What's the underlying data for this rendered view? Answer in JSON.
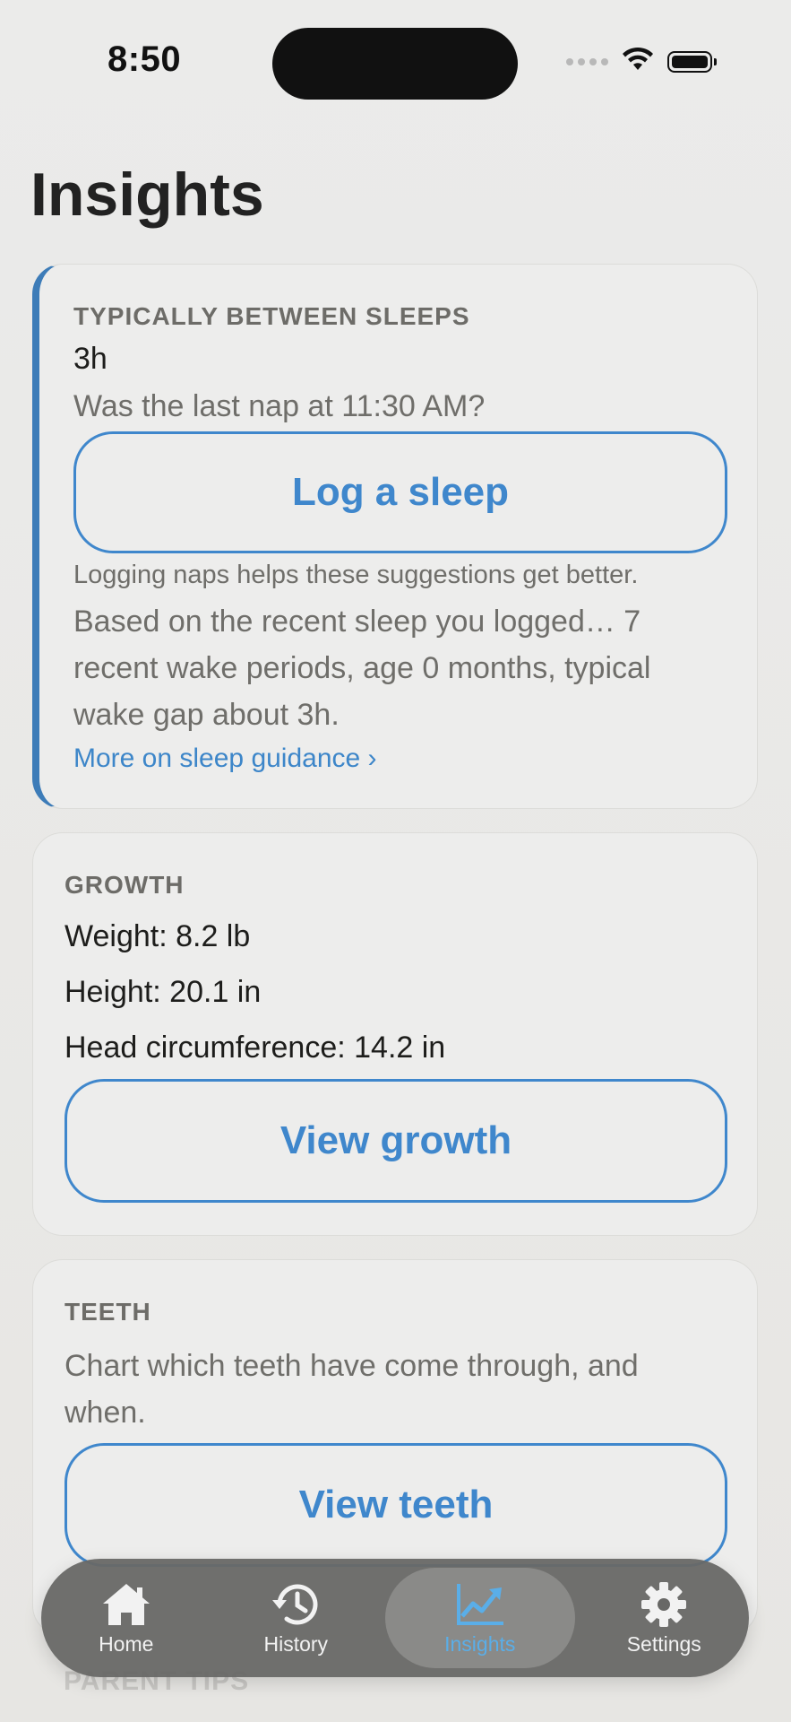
{
  "status_bar": {
    "time": "8:50"
  },
  "page": {
    "title": "Insights"
  },
  "sleep_card": {
    "label": "TYPICALLY BETWEEN SLEEPS",
    "value": "3h",
    "question": "Was the last nap at 11:30 AM?",
    "button_label": "Log a sleep",
    "hint": "Logging naps helps these suggestions get better.",
    "explanation": "Based on the recent sleep you logged… 7 recent wake periods, age 0 months, typical wake gap about 3h.",
    "link_label": "More on sleep guidance ›"
  },
  "growth_card": {
    "label": "GROWTH",
    "weight": "Weight: 8.2 lb",
    "height": "Height: 20.1 in",
    "head": "Head circumference: 14.2 in",
    "button_label": "View growth"
  },
  "teeth_card": {
    "label": "TEETH",
    "description": "Chart which teeth have come through, and when.",
    "button_label": "View teeth"
  },
  "next_card_peek": {
    "label": "PARENT TIPS"
  },
  "tab_bar": {
    "tabs": [
      {
        "label": "Home",
        "icon": "house-icon",
        "active": false
      },
      {
        "label": "History",
        "icon": "history-clock-icon",
        "active": false
      },
      {
        "label": "Insights",
        "icon": "chart-icon",
        "active": true
      },
      {
        "label": "Settings",
        "icon": "gear-icon",
        "active": false
      }
    ]
  },
  "colors": {
    "accent": "#3f87cc",
    "active_tab": "#5aaee8",
    "card_accent_bar": "#3d7cb8"
  }
}
